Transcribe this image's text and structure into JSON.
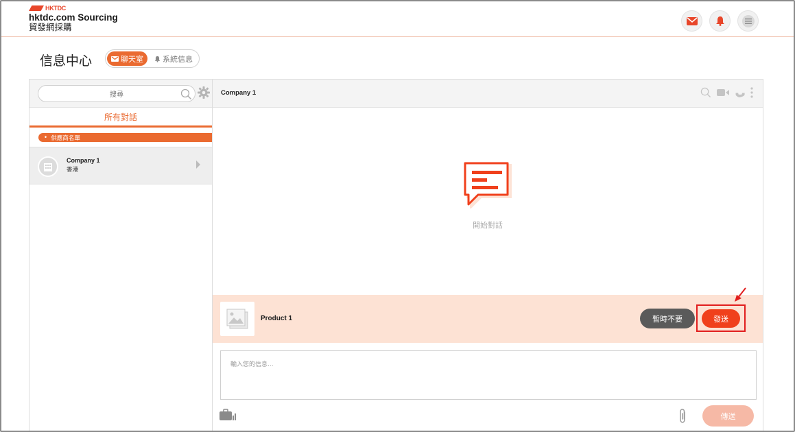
{
  "header": {
    "brand_mark": "HKTDC",
    "title": "hktdc.com Sourcing",
    "subtitle": "貿發網採購",
    "icons": [
      "mail-icon",
      "bell-icon",
      "menu-icon"
    ],
    "accent_color": "#e8462a"
  },
  "page": {
    "title": "信息中心",
    "tabs": [
      {
        "label": "聊天室",
        "icon": "mail-icon",
        "active": true
      },
      {
        "label": "系統信息",
        "icon": "bell-icon",
        "active": false
      }
    ]
  },
  "sidebar": {
    "search_placeholder": "搜尋",
    "filter_tab": "所有對話",
    "category": "供應商名單",
    "conversations": [
      {
        "name": "Company 1",
        "location": "香港"
      }
    ]
  },
  "chat": {
    "title": "Company 1",
    "empty_text": "開始對話",
    "product": {
      "name": "Product 1",
      "decline_label": "暫時不要",
      "send_label": "發送"
    },
    "input_placeholder": "輸入您的信息...",
    "submit_label": "傳送"
  }
}
